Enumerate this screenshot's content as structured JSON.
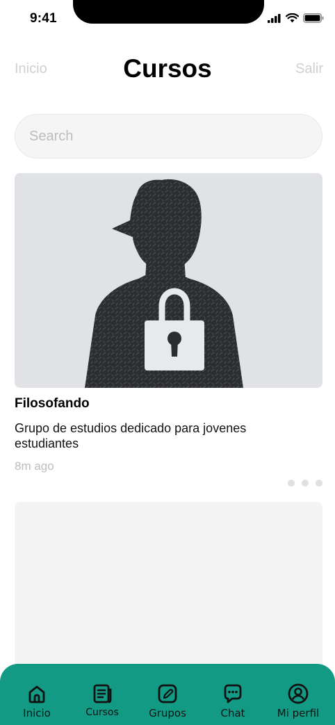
{
  "status_bar": {
    "time": "9:41"
  },
  "header": {
    "left_link": "Inicio",
    "title": "Cursos",
    "right_link": "Salir"
  },
  "search": {
    "placeholder": "Search"
  },
  "cards": [
    {
      "title": "Filosofando",
      "description": "Grupo de estudios dedicado para jovenes estudiantes",
      "time": "8m ago"
    }
  ],
  "tab_bar": {
    "tabs": [
      {
        "label": "Inicio",
        "icon": "home-icon"
      },
      {
        "label": "Cursos",
        "icon": "document-icon"
      },
      {
        "label": "Grupos",
        "icon": "edit-icon"
      },
      {
        "label": "Chat",
        "icon": "chat-icon"
      },
      {
        "label": "Mi perfil",
        "icon": "profile-icon"
      }
    ]
  },
  "colors": {
    "accent": "#129a85",
    "muted_text": "#bdbdbd",
    "card_background": "#e1e2e6"
  }
}
